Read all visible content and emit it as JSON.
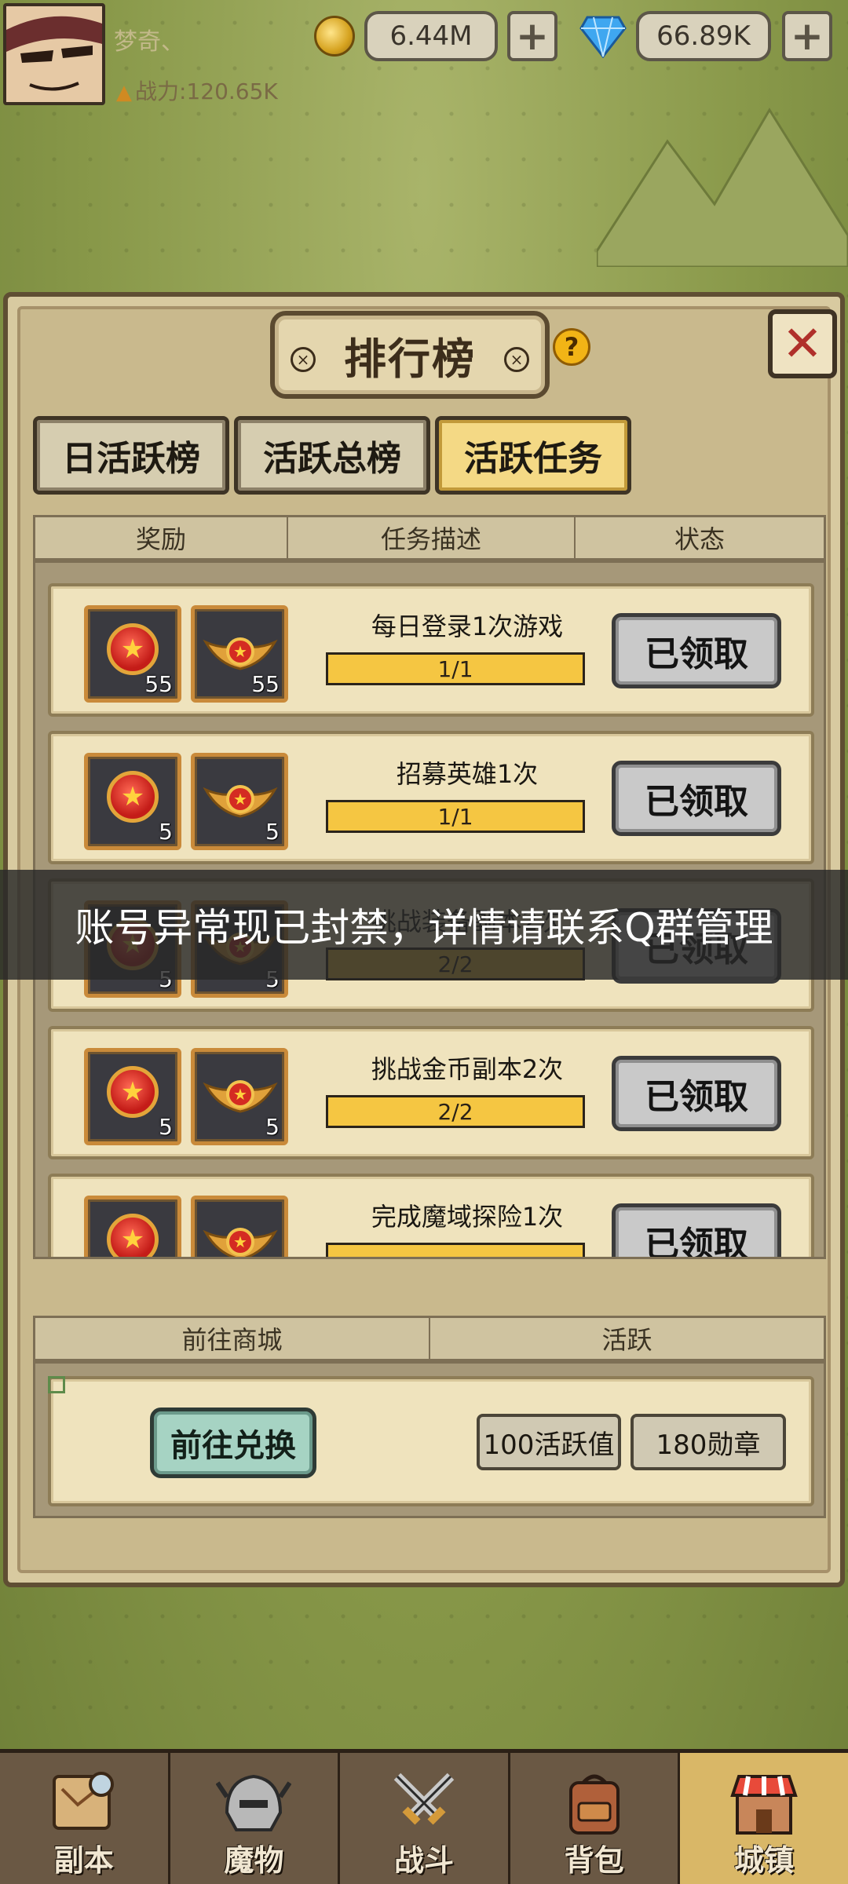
{
  "player": {
    "name": "梦奇、",
    "power": "战力:120.65K"
  },
  "resources": {
    "gold": "6.44M",
    "diamond": "66.89K",
    "gold_icon": "coin-icon",
    "diamond_icon": "diamond-icon"
  },
  "panel": {
    "title": "排行榜",
    "help": "?",
    "close": "X",
    "tabs": [
      {
        "label": "日活跃榜",
        "active": false
      },
      {
        "label": "活跃总榜",
        "active": false
      },
      {
        "label": "活跃任务",
        "active": true
      }
    ],
    "columns": {
      "reward": "奖励",
      "desc": "任务描述",
      "status": "状态"
    },
    "tasks": [
      {
        "desc": "每日登录1次游戏",
        "progress": "1/1",
        "progress_fraction": 1.0,
        "reward1_count": "55",
        "reward2_count": "55",
        "status": "已领取"
      },
      {
        "desc": "招募英雄1次",
        "progress": "1/1",
        "progress_fraction": 1.0,
        "reward1_count": "5",
        "reward2_count": "5",
        "status": "已领取"
      },
      {
        "desc": "挑战装备副本2次",
        "progress": "2/2",
        "progress_fraction": 1.0,
        "reward1_count": "5",
        "reward2_count": "5",
        "status": "已领取"
      },
      {
        "desc": "挑战金币副本2次",
        "progress": "2/2",
        "progress_fraction": 1.0,
        "reward1_count": "5",
        "reward2_count": "5",
        "status": "已领取"
      },
      {
        "desc": "完成魔域探险1次",
        "progress": "",
        "progress_fraction": 1.0,
        "reward1_count": "",
        "reward2_count": "",
        "status": "已领取"
      }
    ],
    "shop": {
      "col_shop": "前往商城",
      "col_active": "活跃",
      "exchange_button": "前往兑换",
      "active_points": "100活跃值",
      "medals": "180勋章"
    }
  },
  "overlay": {
    "message": "账号异常现已封禁，详情请联系Q群管理"
  },
  "nav": [
    {
      "label": "副本",
      "icon": "map-icon",
      "active": false
    },
    {
      "label": "魔物",
      "icon": "monster-helmet-icon",
      "active": false
    },
    {
      "label": "战斗",
      "icon": "crossed-swords-icon",
      "active": false
    },
    {
      "label": "背包",
      "icon": "backpack-icon",
      "active": false
    },
    {
      "label": "城镇",
      "icon": "town-shop-icon",
      "active": true
    }
  ],
  "colors": {
    "active_tab": "#f4d985",
    "progress_fill": "#f5c642",
    "close_x": "#b0302a"
  }
}
